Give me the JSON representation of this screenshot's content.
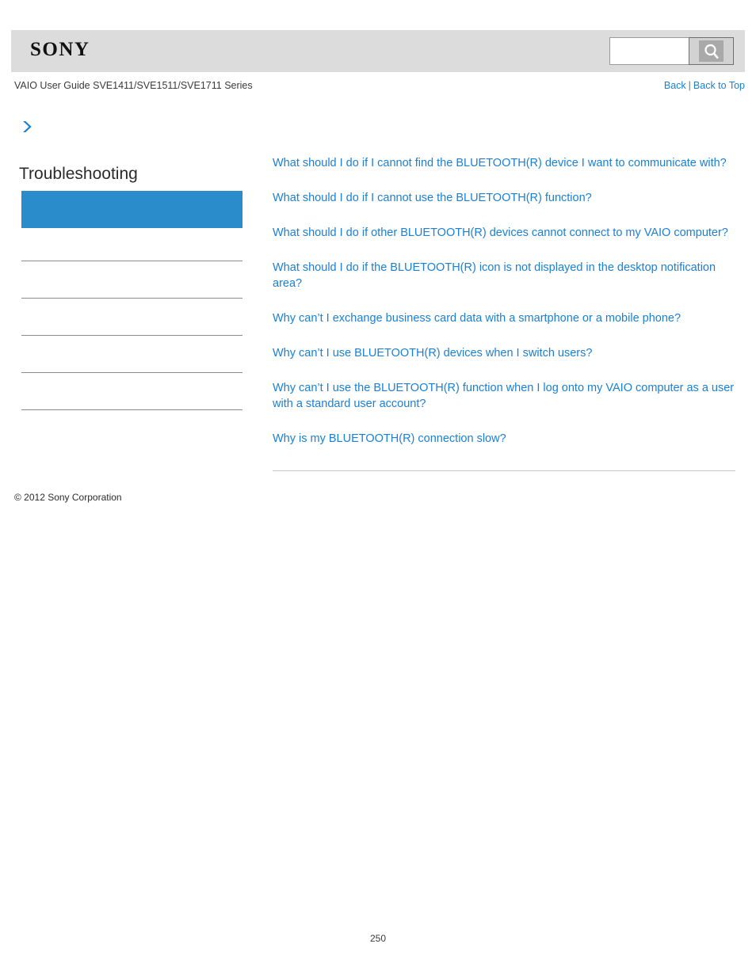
{
  "header": {
    "logo_text": "SONY",
    "logo_icon": "sony-wordmark",
    "search": {
      "value": "",
      "placeholder": "",
      "button_icon": "search-icon",
      "button_label": ""
    }
  },
  "subheader": {
    "guide_title": "VAIO User Guide SVE1411/SVE1511/SVE1711 Series",
    "back_label": "Back",
    "separator": "|",
    "back_to_top_label": "Back to Top"
  },
  "sidebar": {
    "breadcrumb_icon": "chevron-right-icon",
    "section_title": "Troubleshooting",
    "accent_color": "#2b8ccc",
    "items": [
      {
        "label": "",
        "selected": true
      },
      {
        "label": "",
        "selected": false
      },
      {
        "label": "",
        "selected": false
      },
      {
        "label": "",
        "selected": false
      },
      {
        "label": "",
        "selected": false
      },
      {
        "label": "",
        "selected": false
      }
    ],
    "copyright": "© 2012 Sony Corporation"
  },
  "content": {
    "link_color": "#1b7fd4",
    "links": [
      "What should I do if I cannot find the BLUETOOTH(R) device I want to communicate with?",
      "What should I do if I cannot use the BLUETOOTH(R) function?",
      "What should I do if other BLUETOOTH(R) devices cannot connect to my VAIO computer?",
      "What should I do if the BLUETOOTH(R) icon is not displayed in the desktop notification area?",
      "Why can’t I exchange business card data with a smartphone or a mobile phone?",
      "Why can’t I use BLUETOOTH(R) devices when I switch users?",
      "Why can’t I use the BLUETOOTH(R) function when I log onto my VAIO computer as a user with a standard user account?",
      "Why is my BLUETOOTH(R) connection slow?"
    ]
  },
  "footer": {
    "page_number": "250"
  }
}
